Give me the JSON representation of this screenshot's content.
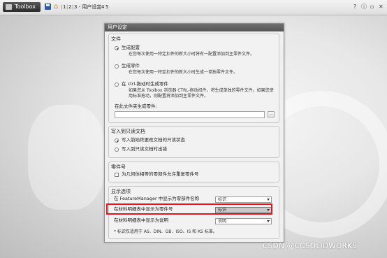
{
  "app": {
    "title": "Toolbox",
    "breadcrumb": [
      "1",
      "2",
      "3 - 用户设定",
      "4",
      "5"
    ],
    "separators": [
      "|",
      "|",
      "|",
      "|"
    ],
    "window_icons": [
      "help-icon",
      "info-icon",
      "minimize-icon",
      "close-icon"
    ]
  },
  "dialog": {
    "title": "用户设定",
    "file_group": {
      "title": "文件",
      "options": [
        {
          "label": "生成配置",
          "selected": true,
          "desc": [
            "在您每次使用一特定扣件的新大小时将有一配置添加到主零件文件。"
          ]
        },
        {
          "label": "生成零件",
          "selected": false,
          "desc": [
            "在您每次使用一特定扣件的新大小时生成一单独零件文件。"
          ]
        },
        {
          "label": "在 ctrl-拖动时生成零件",
          "selected": false,
          "desc": [
            "如果您从 Toolbox 浏览器 CTRL-拖动扣件，将生成单独的零件文件。如果您使",
            "用标准拖动，则配置将添加到主零件文件。"
          ]
        }
      ],
      "folder_label": "在此文件夹生成零件:",
      "folder_value": "",
      "browse_label": "..."
    },
    "readonly_group": {
      "title": "写入到只读文档",
      "options": [
        {
          "label": "写入前始终更改文档的只读状态",
          "selected": true
        },
        {
          "label": "写入到只读文档时出错",
          "selected": false
        }
      ]
    },
    "partnum_group": {
      "title": "零件号",
      "checkbox_label": "为几何体相等的零部件允许重复零件号",
      "checked": false
    },
    "display_group": {
      "title": "显示选项",
      "rows": [
        {
          "label": "在 FeatureManager 中显示为零部件名称",
          "value": "标识"
        },
        {
          "label": "在材料明细表中显示为零件号",
          "value": "标识"
        },
        {
          "label": "在材料明细表中显示为说明",
          "value": "说明"
        }
      ],
      "footnote": "* 标识仅适用于 AS、DIN、GB、ISO、IS 和 KS 标准。"
    }
  },
  "watermark": "CSDN @CCSOLIDWORKS",
  "colors": {
    "highlight": "#e0191b",
    "titlebar_tab": "#2b2b2b",
    "dialog_header": "#5f5f5f"
  }
}
